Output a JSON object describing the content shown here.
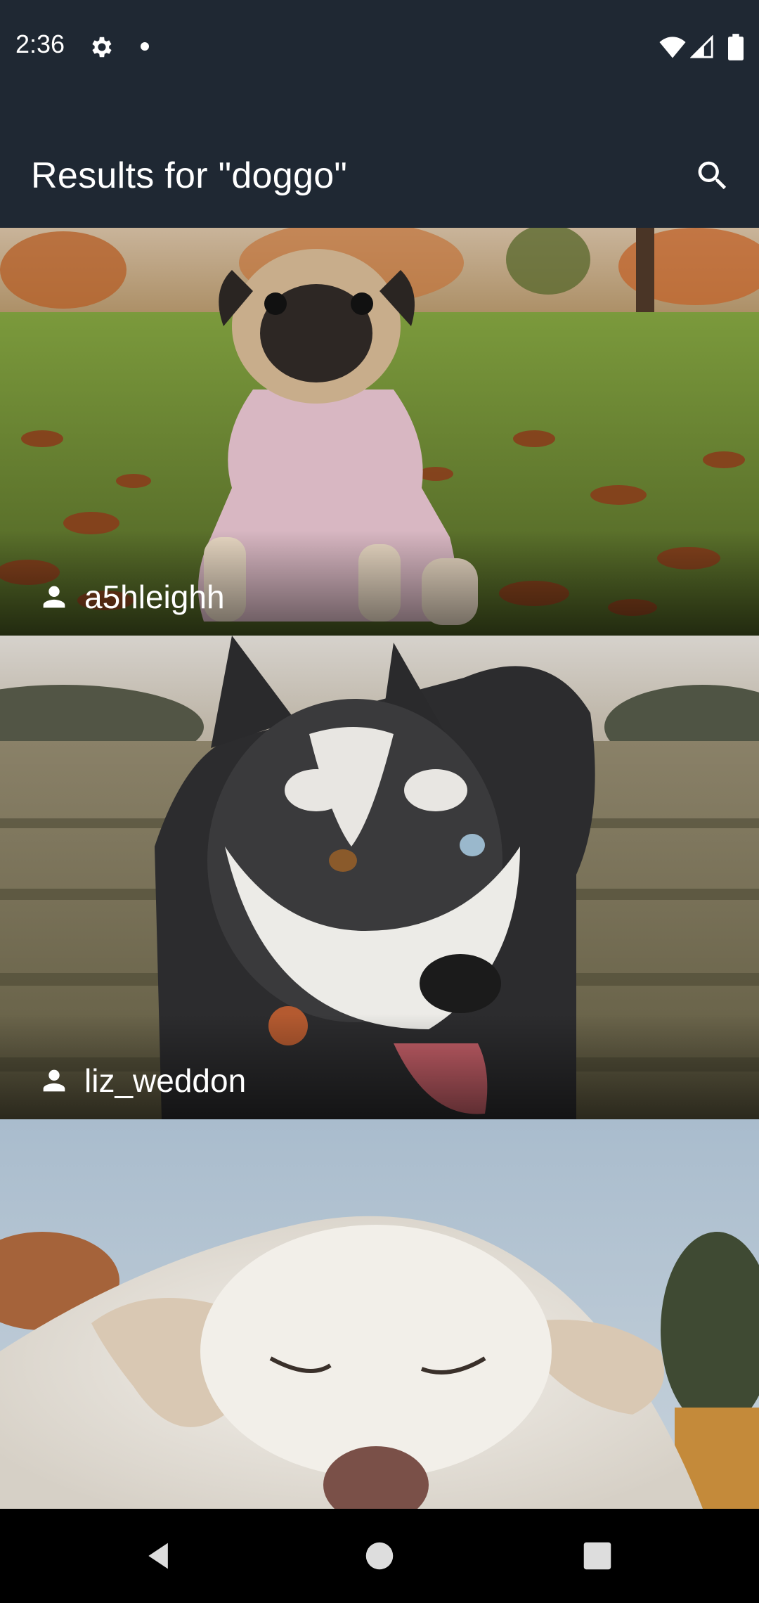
{
  "status_bar": {
    "time": "2:36",
    "icons": [
      "gear-icon",
      "notification-dot-icon",
      "wifi-icon",
      "cell-signal-icon",
      "battery-icon"
    ]
  },
  "app_bar": {
    "title": "Results for \"doggo\"",
    "search_icon": "search-icon",
    "background": "#1f2833"
  },
  "results": [
    {
      "author": "a5hleighh",
      "subject": "pug in pink sweater on autumn leaves"
    },
    {
      "author": "liz_weddon",
      "subject": "husky in a field"
    },
    {
      "author": "",
      "subject": "white dog lying down, eyes closed"
    }
  ],
  "nav_bar": {
    "icons": [
      "back-icon",
      "home-icon",
      "recents-icon"
    ]
  }
}
